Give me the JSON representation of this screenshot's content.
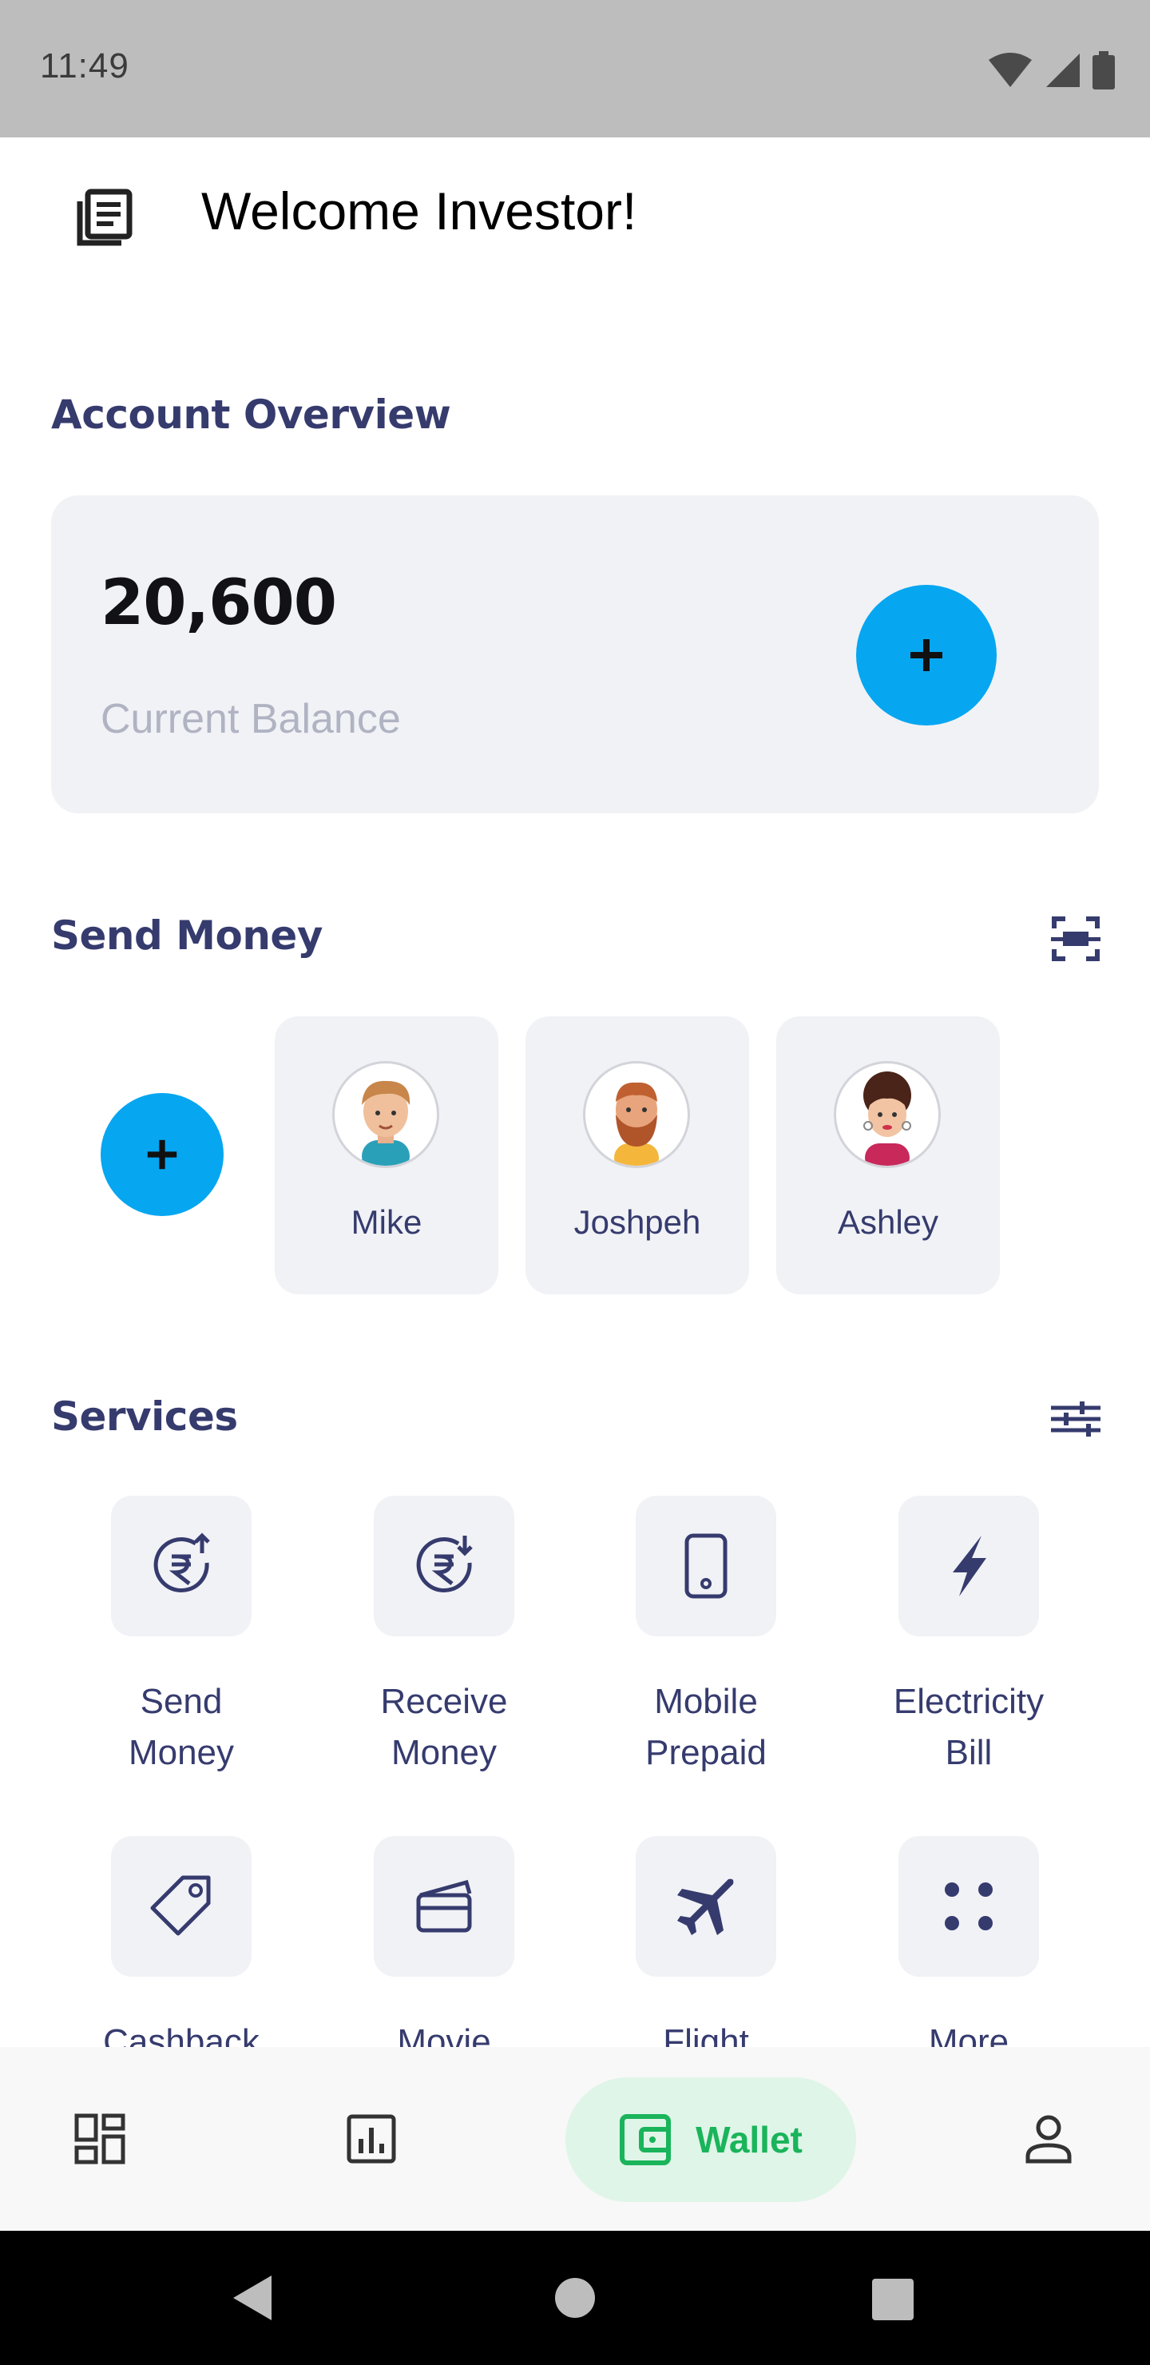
{
  "status_bar": {
    "time": "11:49"
  },
  "header": {
    "title": "Welcome Investor!",
    "menu_icon": "news-menu-icon"
  },
  "account_overview": {
    "title": "Account Overview",
    "balance": "20,600",
    "balance_label": "Current Balance",
    "add_icon": "plus"
  },
  "send_money": {
    "title": "Send Money",
    "add_icon": "plus",
    "contacts": [
      {
        "name": "Mike"
      },
      {
        "name": "Joshpeh"
      },
      {
        "name": "Ashley"
      }
    ]
  },
  "services": {
    "title": "Services",
    "items": [
      {
        "label_line1": "Send",
        "label_line2": "Money",
        "icon": "rupee-send-icon"
      },
      {
        "label_line1": "Receive",
        "label_line2": "Money",
        "icon": "rupee-receive-icon"
      },
      {
        "label_line1": "Mobile",
        "label_line2": "Prepaid",
        "icon": "mobile-icon"
      },
      {
        "label_line1": "Electricity",
        "label_line2": "Bill",
        "icon": "lightning-icon"
      },
      {
        "label_line1": "Cashback",
        "label_line2": "",
        "icon": "tag-icon"
      },
      {
        "label_line1": "Movie",
        "label_line2": "",
        "icon": "movie-ticket-icon"
      },
      {
        "label_line1": "Flight",
        "label_line2": "",
        "icon": "airplane-icon"
      },
      {
        "label_line1": "More",
        "label_line2": "",
        "icon": "more-dots-icon"
      }
    ]
  },
  "bottom_nav": {
    "active_label": "Wallet",
    "items": [
      "dashboard-icon",
      "chart-icon",
      "wallet-icon",
      "profile-icon"
    ]
  },
  "colors": {
    "accent": "#07a6f0",
    "heading": "#363b6e",
    "card_bg": "#f1f2f6",
    "active_nav": "#1ab45a"
  }
}
